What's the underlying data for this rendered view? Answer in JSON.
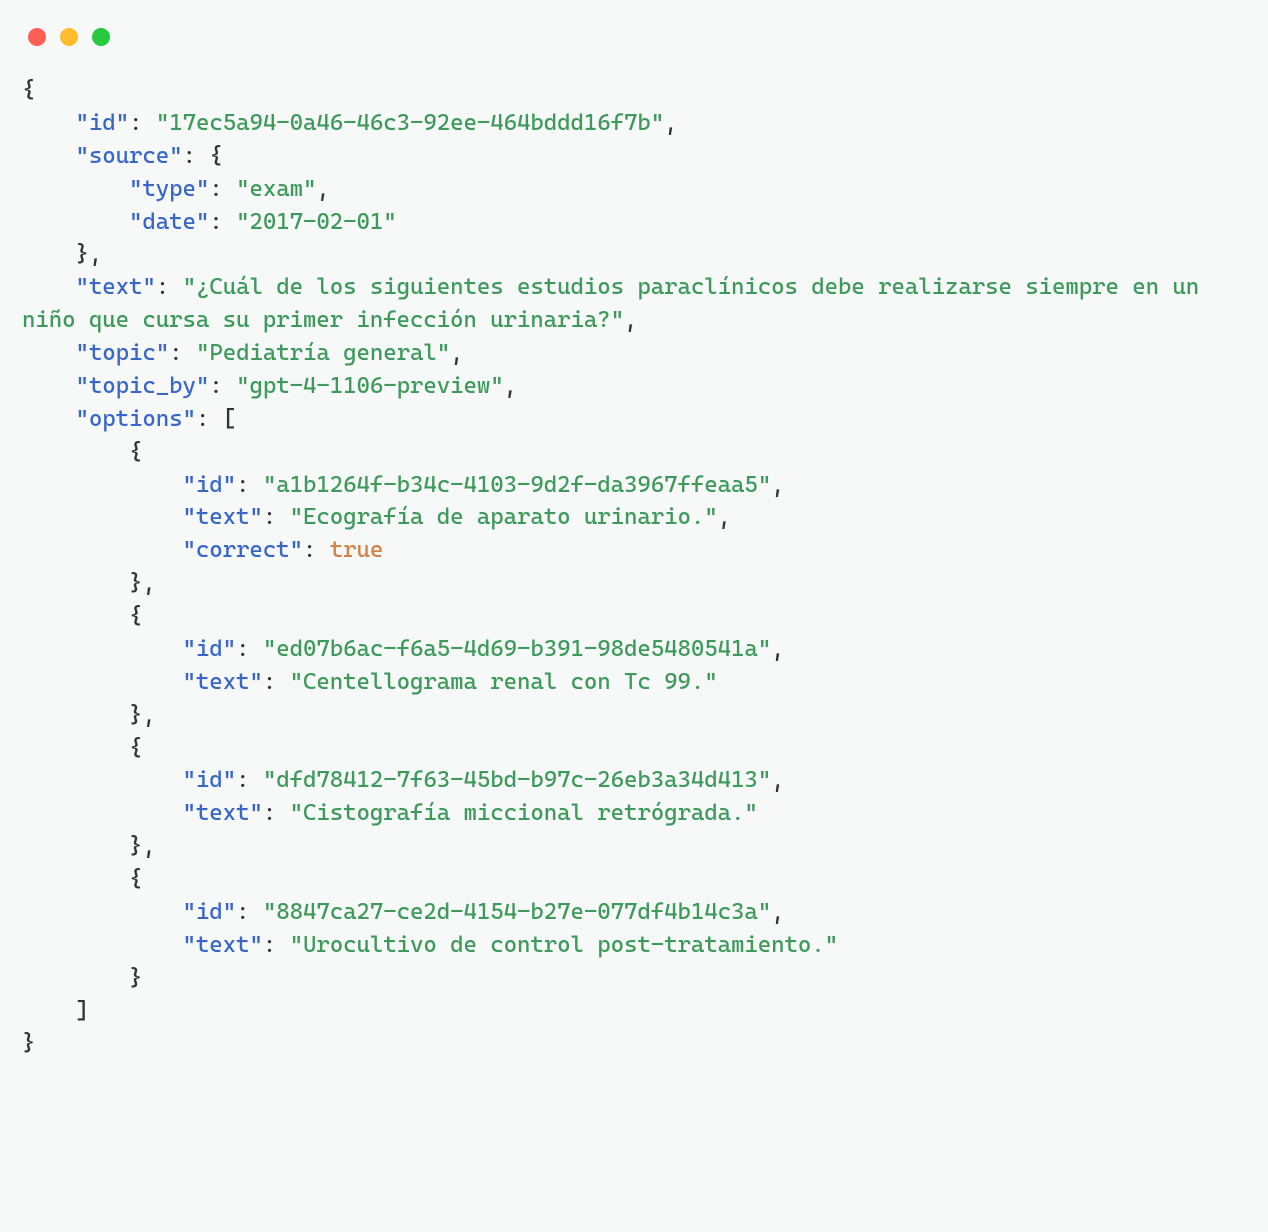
{
  "traffic_lights": {
    "close": "close",
    "minimize": "minimize",
    "maximize": "maximize"
  },
  "json": {
    "keys": {
      "id": "\"id\"",
      "source": "\"source\"",
      "type": "\"type\"",
      "date": "\"date\"",
      "text": "\"text\"",
      "topic": "\"topic\"",
      "topic_by": "\"topic_by\"",
      "options": "\"options\"",
      "correct": "\"correct\""
    },
    "root_id": "\"17ec5a94-0a46-46c3-92ee-464bddd16f7b\"",
    "source_type": "\"exam\"",
    "source_date": "\"2017-02-01\"",
    "root_text": "\"¿Cuál de los siguientes estudios paraclínicos debe realizarse siempre en un niño que cursa su primer infección urinaria?\"",
    "topic": "\"Pediatría general\"",
    "topic_by": "\"gpt-4-1106-preview\"",
    "opt1_id": "\"a1b1264f-b34c-4103-9d2f-da3967ffeaa5\"",
    "opt1_text": "\"Ecografía de aparato urinario.\"",
    "opt1_correct": "true",
    "opt2_id": "\"ed07b6ac-f6a5-4d69-b391-98de5480541a\"",
    "opt2_text": "\"Centellograma renal con Tc 99.\"",
    "opt3_id": "\"dfd78412-7f63-45bd-b97c-26eb3a34d413\"",
    "opt3_text": "\"Cistografía miccional retrógrada.\"",
    "opt4_id": "\"8847ca27-ce2d-4154-b27e-077df4b14c3a\"",
    "opt4_text": "\"Urocultivo de control post-tratamiento.\""
  }
}
